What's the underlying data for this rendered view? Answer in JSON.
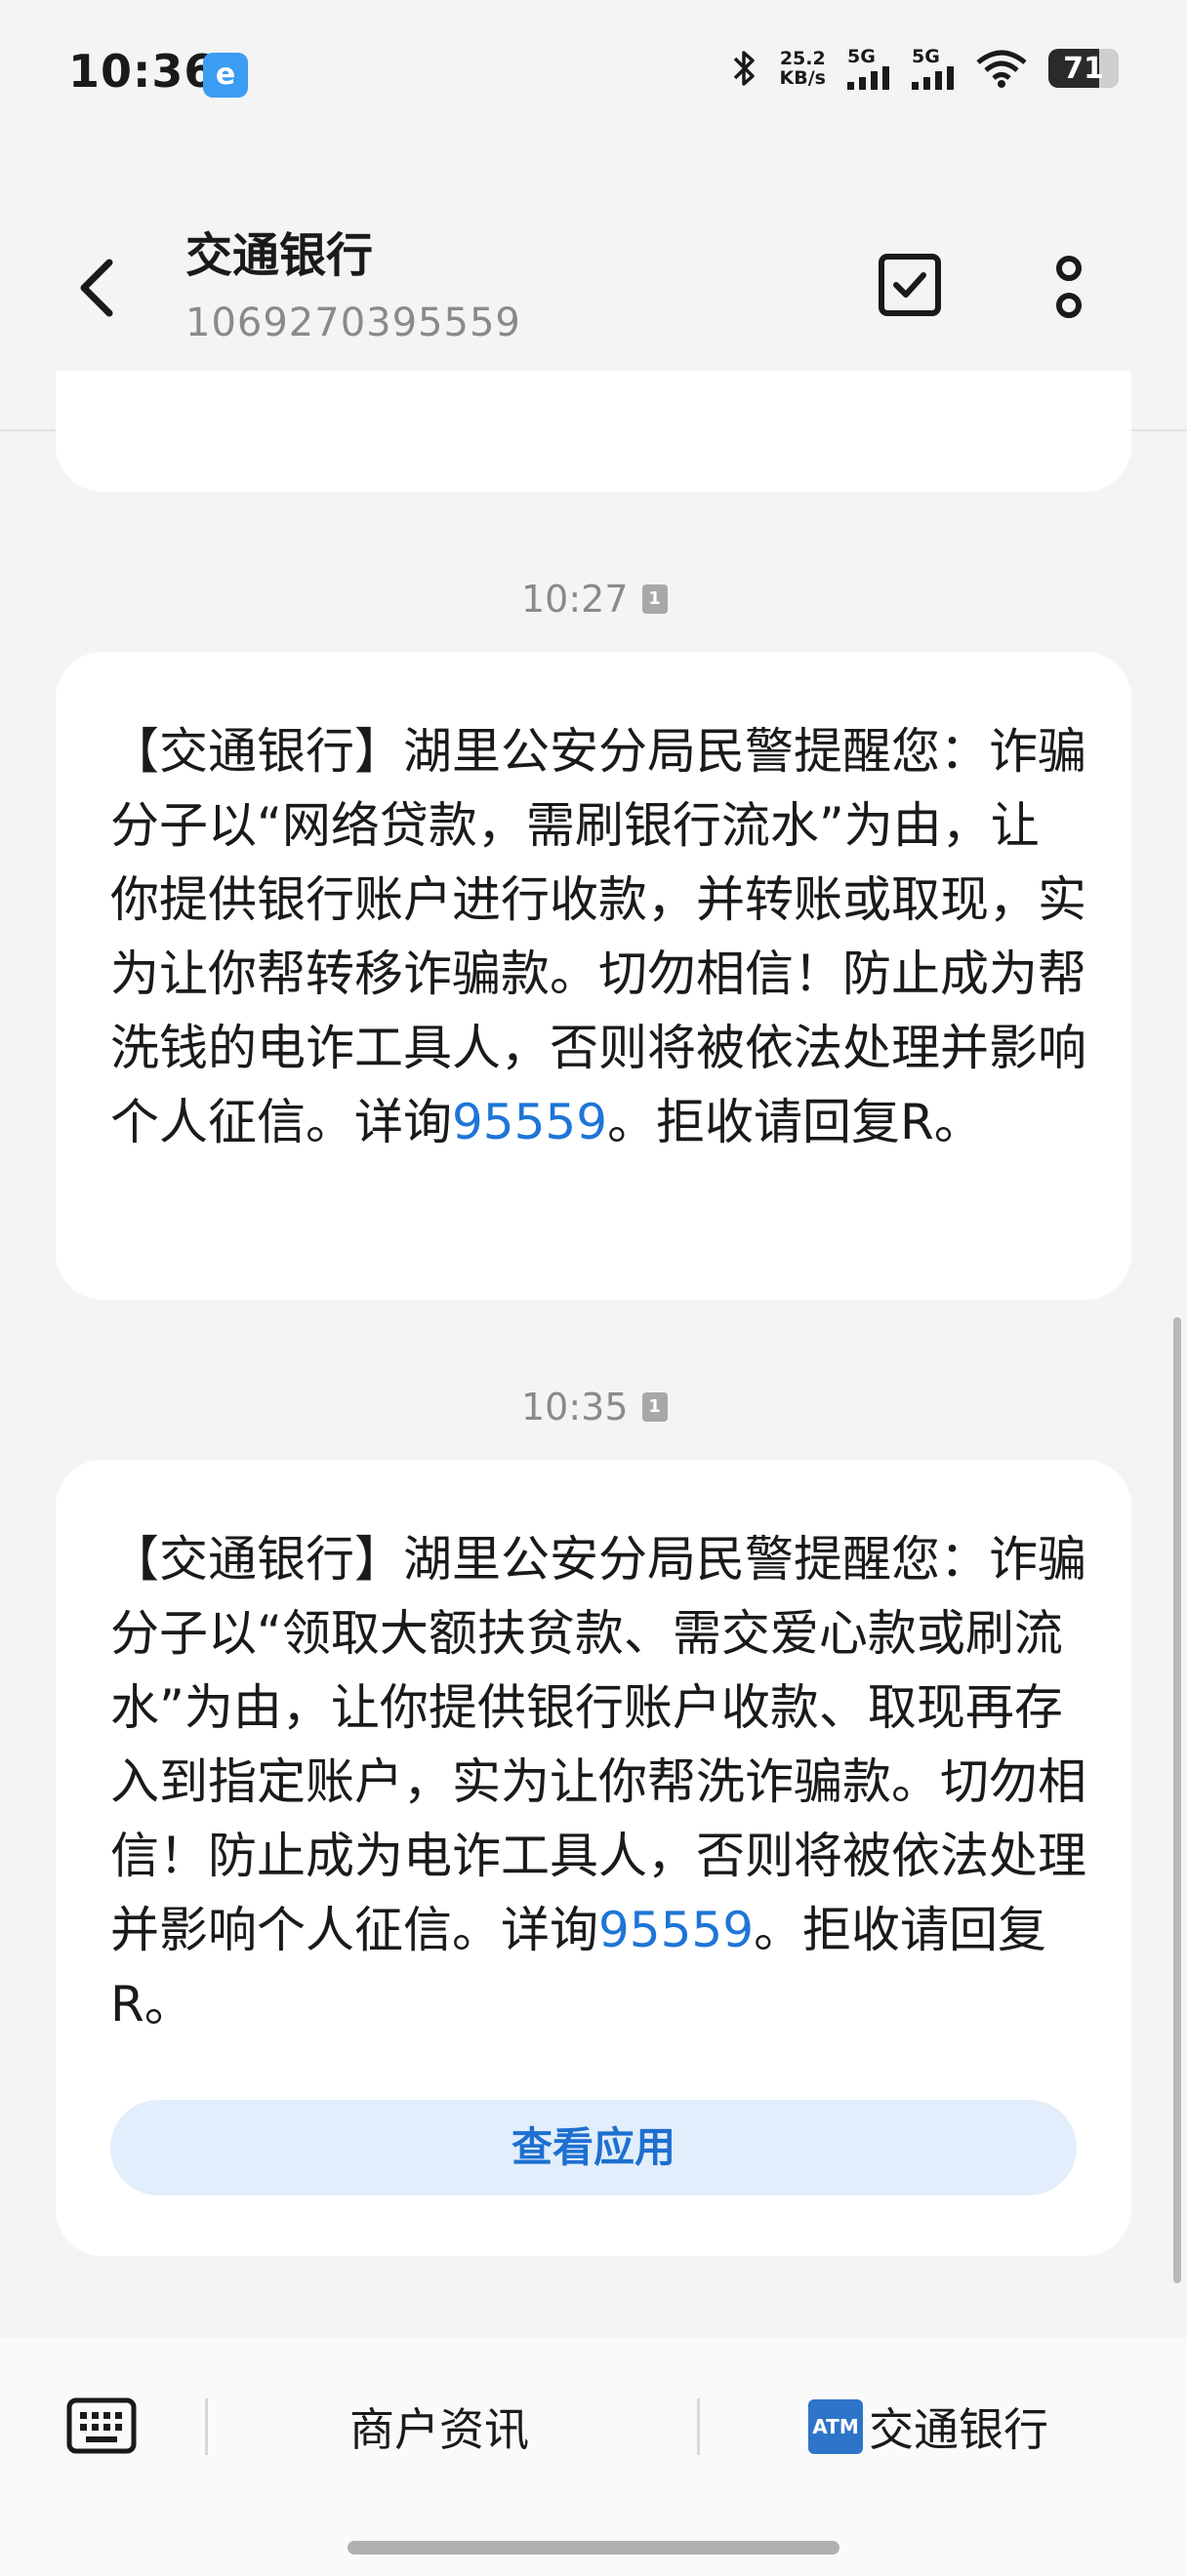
{
  "status_bar": {
    "time": "10:36",
    "app_icon_glyph": "e",
    "net_speed_value": "25.2",
    "net_speed_unit": "KB/s",
    "signal1_label": "5G",
    "signal2_label": "5G",
    "battery": "71"
  },
  "header": {
    "contact_name": "交通银行",
    "contact_number": "1069270395559"
  },
  "messages": [
    {
      "time": "10:27",
      "sim": "1",
      "text_before": "【交通银行】湖里公安分局民警提醒您：诈骗分子以“网络贷款，需刷银行流水”为由，让你提供银行账户进行收款，并转账或取现，实为让你帮转移诈骗款。切勿相信！防止成为帮洗钱的电诈工具人，否则将被依法处理并影响个人征信。详询",
      "link": "95559",
      "text_after": "。拒收请回复R。"
    },
    {
      "time": "10:35",
      "sim": "1",
      "text_before": "【交通银行】湖里公安分局民警提醒您：诈骗分子以“领取大额扶贫款、需交爱心款或刷流水”为由，让你提供银行账户收款、取现再存入到指定账户，实为让你帮洗诈骗款。切勿相信！防止成为电诈工具人，否则将被依法处理并影响个人征信。详询",
      "link": "95559",
      "text_after": "。拒收请回复R。",
      "button_label": "查看应用"
    }
  ],
  "bottom_bar": {
    "menu1": "商户资讯",
    "menu2_badge": "ATM",
    "menu2": "交通银行"
  },
  "icons": {
    "back": "chevron-left-icon",
    "check": "checkbox-icon",
    "more": "more-vertical-icon",
    "keyboard": "keyboard-icon"
  },
  "colors": {
    "link": "#1e75d6",
    "button_bg": "#e2eefb",
    "atm_badge": "#2e74c9"
  }
}
